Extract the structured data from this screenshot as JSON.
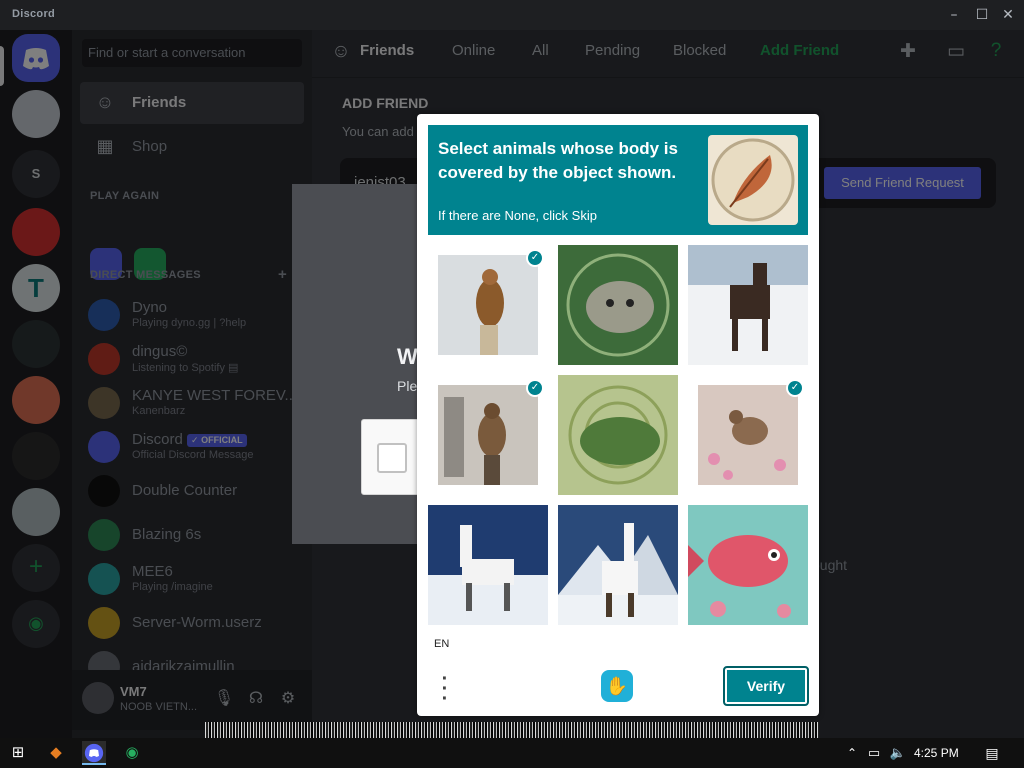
{
  "window": {
    "brand": "Discord",
    "controls": [
      "–",
      "☐",
      "✕"
    ]
  },
  "sidebar": {
    "search_placeholder": "Find or start a conversation",
    "nav": [
      {
        "label": "Friends",
        "icon": "friends-icon"
      },
      {
        "label": "Shop",
        "icon": "shop-icon"
      }
    ],
    "play_again_header": "PLAY AGAIN",
    "dm_header": "DIRECT MESSAGES",
    "dm_add": "+",
    "dms": [
      {
        "name": "Dyno",
        "status": "Playing dyno.gg | ?help",
        "color": "#2f5fb3"
      },
      {
        "name": "dingus©",
        "status": "Listening to Spotify ▤",
        "color": "#c0392b"
      },
      {
        "name": "KANYE WEST FOREV...",
        "status": "Kanenbarz",
        "color": "#7a6a4f"
      },
      {
        "name": "Discord",
        "badge": "✓ OFFICIAL",
        "status": "Official Discord Message",
        "color": "#5865f2"
      },
      {
        "name": "Double Counter",
        "status": "",
        "color": "#111111"
      },
      {
        "name": "Blazing 6s",
        "status": "",
        "color": "#2e8b57"
      },
      {
        "name": "MEE6",
        "status": "Playing /imagine",
        "color": "#2aa5a5"
      },
      {
        "name": "Server-Worm.userz",
        "status": "",
        "color": "#c9a227"
      },
      {
        "name": "aidarikzaimullin",
        "status": "",
        "color": "#6b6e76"
      }
    ],
    "user": {
      "name": "VM7",
      "status": "NOOB VIETN..."
    }
  },
  "topbar": {
    "title": "Friends",
    "tabs": [
      "Online",
      "All",
      "Pending",
      "Blocked"
    ],
    "add_friend": "Add Friend"
  },
  "add_friend": {
    "title": "ADD FRIEND",
    "desc": "You can add",
    "input_value": "jenist03",
    "button": "Send Friend Request",
    "faint_text": "ought"
  },
  "under_modal": {
    "heading": "W",
    "text": "Ple"
  },
  "captcha": {
    "question": "Select animals whose body is covered by the object shown.",
    "hint": "If there are None, click Skip",
    "example": "feather",
    "tiles": [
      {
        "subject": "hawk-on-post",
        "selected": true
      },
      {
        "subject": "cat-in-leaves",
        "selected": false
      },
      {
        "subject": "horse-in-snow",
        "selected": false
      },
      {
        "subject": "falcon-on-post",
        "selected": true
      },
      {
        "subject": "frog-in-swirl",
        "selected": false
      },
      {
        "subject": "hawk-in-flowers",
        "selected": true
      },
      {
        "subject": "llama-on-snow",
        "selected": false
      },
      {
        "subject": "llama-on-mountain",
        "selected": false
      },
      {
        "subject": "fish-painting",
        "selected": false
      }
    ],
    "lang": "EN",
    "verify": "Verify"
  },
  "taskbar": {
    "time": "4:25 PM"
  },
  "colors": {
    "accent": "#5865f2",
    "teal": "#00838f",
    "green": "#23a559"
  }
}
